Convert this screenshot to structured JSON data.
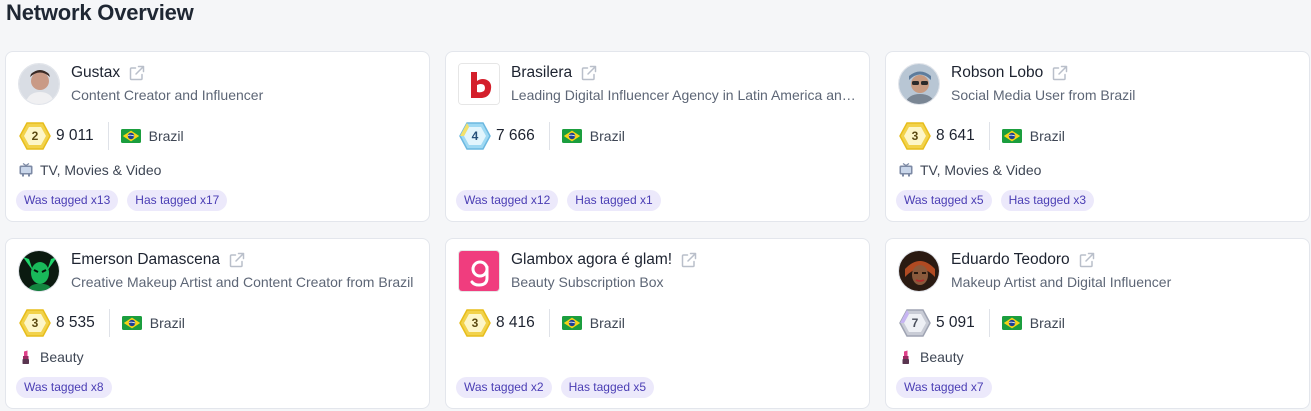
{
  "page": {
    "title": "Network Overview"
  },
  "colors": {
    "tag_bg": "#ece9fb",
    "tag_text": "#4a3db4",
    "gold": "#f3d64b",
    "blue": "#8fd3f4"
  },
  "cards": [
    {
      "name": "Gustax",
      "subtitle": "Content Creator and Influencer",
      "level": "2",
      "followers": "9 011",
      "country": "Brazil",
      "category": "TV, Movies & Video",
      "tag_was": "Was tagged x13",
      "tag_has": "Has tagged x17"
    },
    {
      "name": "Brasilera",
      "subtitle": "Leading Digital Influencer Agency in Latin America and Brazil",
      "level": "4",
      "followers": "7 666",
      "country": "Brazil",
      "tag_was": "Was tagged x12",
      "tag_has": "Has tagged x1"
    },
    {
      "name": "Robson Lobo",
      "subtitle": "Social Media User from Brazil",
      "level": "3",
      "followers": "8 641",
      "country": "Brazil",
      "category": "TV, Movies & Video",
      "tag_was": "Was tagged x5",
      "tag_has": "Has tagged x3"
    },
    {
      "name": "Emerson Damascena",
      "subtitle": "Creative Makeup Artist and Content Creator from Brazil",
      "level": "3",
      "followers": "8 535",
      "country": "Brazil",
      "category": "Beauty",
      "tag_was": "Was tagged x8"
    },
    {
      "name": "Glambox agora é glam!",
      "subtitle": "Beauty Subscription Box",
      "level": "3",
      "followers": "8 416",
      "country": "Brazil",
      "tag_was": "Was tagged x2",
      "tag_has": "Has tagged x5"
    },
    {
      "name": "Eduardo Teodoro",
      "subtitle": "Makeup Artist and Digital Influencer",
      "level": "7",
      "followers": "5 091",
      "country": "Brazil",
      "category": "Beauty",
      "tag_was": "Was tagged x7"
    }
  ]
}
